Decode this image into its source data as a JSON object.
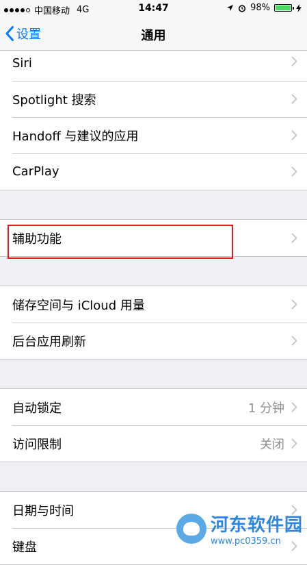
{
  "status_bar": {
    "carrier": "中国移动",
    "network": "4G",
    "time": "14:47",
    "battery": "98%",
    "battery_level": 0.98
  },
  "nav": {
    "back_label": "设置",
    "title": "通用"
  },
  "groups": [
    {
      "rows": [
        {
          "label": "Siri",
          "value": ""
        },
        {
          "label": "Spotlight 搜索",
          "value": ""
        },
        {
          "label": "Handoff 与建议的应用",
          "value": ""
        },
        {
          "label": "CarPlay",
          "value": ""
        }
      ]
    },
    {
      "rows": [
        {
          "label": "辅助功能",
          "value": ""
        }
      ]
    },
    {
      "rows": [
        {
          "label": "储存空间与 iCloud 用量",
          "value": ""
        },
        {
          "label": "后台应用刷新",
          "value": ""
        }
      ]
    },
    {
      "rows": [
        {
          "label": "自动锁定",
          "value": "1 分钟"
        },
        {
          "label": "访问限制",
          "value": "关闭"
        }
      ]
    },
    {
      "rows": [
        {
          "label": "日期与时间",
          "value": ""
        },
        {
          "label": "键盘",
          "value": ""
        }
      ]
    }
  ],
  "watermark": {
    "name": "河东软件园",
    "url": "www.pc0359.cn"
  },
  "colors": {
    "accent": "#007aff",
    "highlight": "#e01b1b",
    "battery": "#4cd964"
  }
}
